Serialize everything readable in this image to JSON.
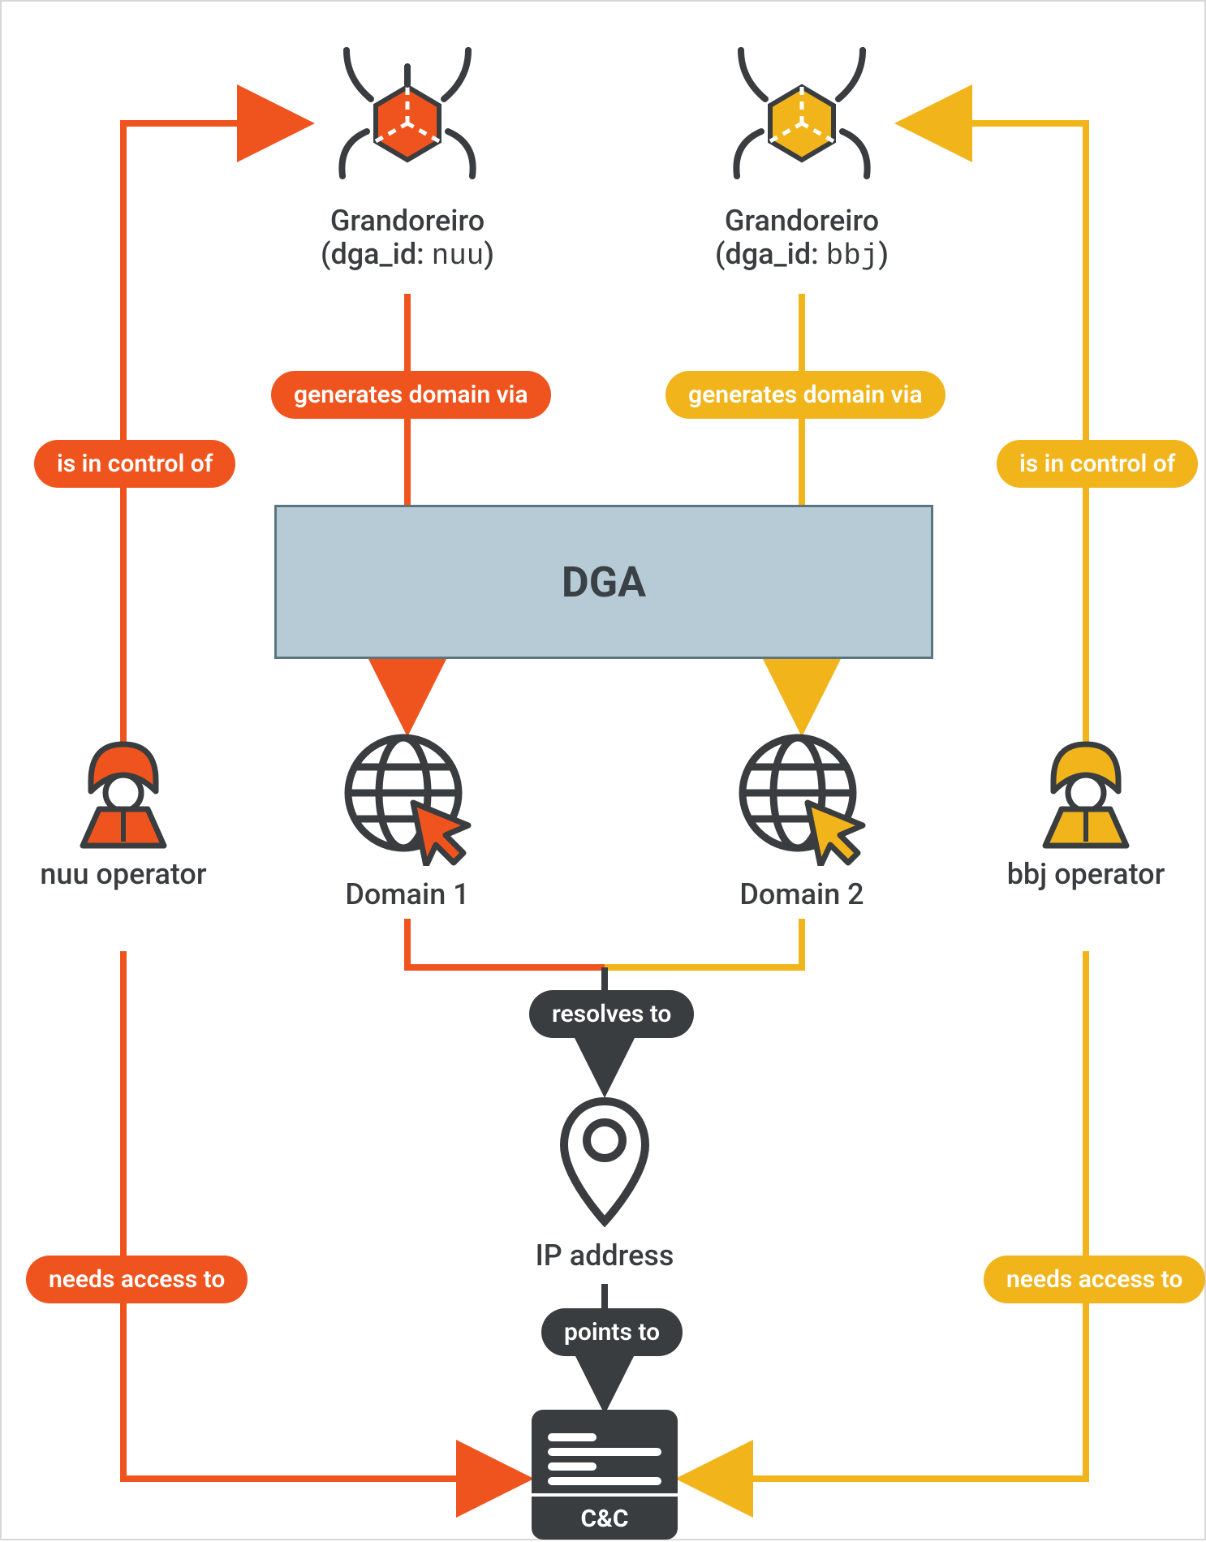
{
  "malware_left": {
    "name": "Grandoreiro",
    "field": "dga_id",
    "value": "nuu"
  },
  "malware_right": {
    "name": "Grandoreiro",
    "field": "dga_id",
    "value": "bbj"
  },
  "dga_label": "DGA",
  "domain_left": "Domain 1",
  "domain_right": "Domain 2",
  "ip_label": "IP address",
  "cc_label": "C&C",
  "operator_left": "nuu operator",
  "operator_right": "bbj operator",
  "edges": {
    "in_control_left": "is in control of",
    "in_control_right": "is in control of",
    "gen_left": "generates domain via",
    "gen_right": "generates domain via",
    "resolves": "resolves to",
    "points": "points to",
    "access_left": "needs access to",
    "access_right": "needs access to"
  },
  "colors": {
    "orange": "#f0541e",
    "amber": "#f2b41b",
    "dark": "#3a3d3f",
    "steel": "#b7cbd6"
  }
}
